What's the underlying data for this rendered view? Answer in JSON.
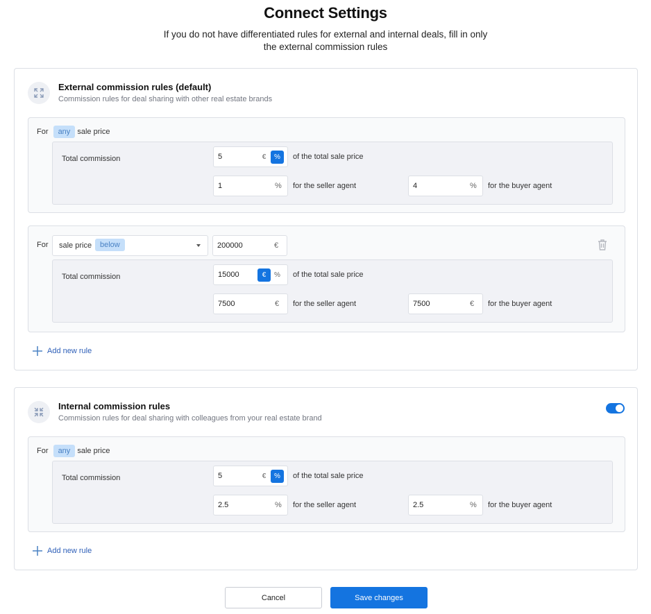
{
  "page": {
    "title": "Connect Settings",
    "subtitle": "If you do not have differentiated rules for external and internal deals, fill in only the external commission rules"
  },
  "external": {
    "icon": "expand-icon",
    "title": "External commission rules (default)",
    "description": "Commission rules for deal sharing with other real estate brands",
    "add_rule_label": "Add new rule",
    "rules": [
      {
        "for_label": "For",
        "condition_pill": "any",
        "condition_suffix": "sale price",
        "total_label": "Total commission",
        "total_value": "5",
        "unit_eur": "€",
        "unit_pct": "%",
        "active_unit": "%",
        "total_suffix": "of the total sale price",
        "seller_value": "1",
        "seller_unit": "%",
        "seller_suffix": "for the seller agent",
        "buyer_value": "4",
        "buyer_unit": "%",
        "buyer_suffix": "for the buyer agent"
      },
      {
        "for_label": "For",
        "select_text": "sale price",
        "select_pill": "below",
        "threshold_value": "200000",
        "threshold_unit": "€",
        "delete_icon": "trash-icon",
        "total_label": "Total commission",
        "total_value": "15000",
        "unit_eur": "€",
        "unit_pct": "%",
        "active_unit": "€",
        "total_suffix": "of the total sale price",
        "seller_value": "7500",
        "seller_unit": "€",
        "seller_suffix": "for the seller agent",
        "buyer_value": "7500",
        "buyer_unit": "€",
        "buyer_suffix": "for the buyer agent"
      }
    ]
  },
  "internal": {
    "icon": "collapse-icon",
    "title": "Internal commission rules",
    "description": "Commission rules for deal sharing with colleagues from your real estate brand",
    "enabled": true,
    "add_rule_label": "Add new rule",
    "rules": [
      {
        "for_label": "For",
        "condition_pill": "any",
        "condition_suffix": "sale price",
        "total_label": "Total commission",
        "total_value": "5",
        "unit_eur": "€",
        "unit_pct": "%",
        "active_unit": "%",
        "total_suffix": "of the total sale price",
        "seller_value": "2.5",
        "seller_unit": "%",
        "seller_suffix": "for the seller agent",
        "buyer_value": "2.5",
        "buyer_unit": "%",
        "buyer_suffix": "for the buyer agent"
      }
    ]
  },
  "footer": {
    "cancel_label": "Cancel",
    "save_label": "Save changes"
  },
  "colors": {
    "accent": "#1474e0",
    "pill_bg": "#c5dffa",
    "link": "#2e5fb8"
  }
}
